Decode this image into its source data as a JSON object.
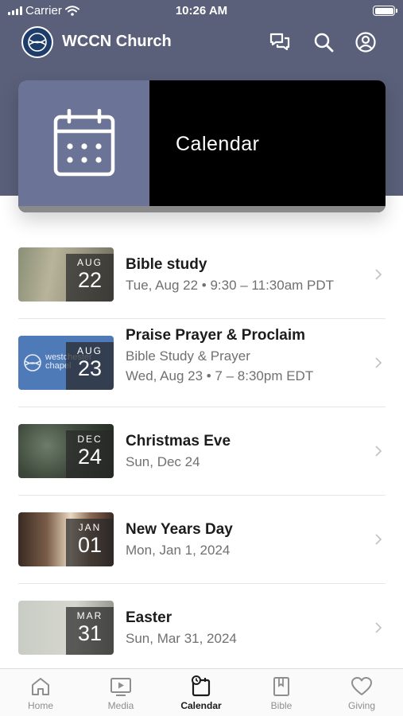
{
  "status_bar": {
    "carrier": "Carrier",
    "time": "10:26 AM"
  },
  "header": {
    "title": "WCCN Church"
  },
  "hero": {
    "title": "Calendar"
  },
  "events": [
    {
      "month": "AUG",
      "day": "22",
      "title": "Bible study",
      "lines": [
        "Tue, Aug 22 • 9:30 – 11:30am PDT"
      ]
    },
    {
      "month": "AUG",
      "day": "23",
      "title": "Praise Prayer & Proclaim",
      "lines": [
        "Bible Study & Prayer",
        "Wed, Aug 23 • 7 – 8:30pm EDT"
      ],
      "thumb_text": "westchester chapel"
    },
    {
      "month": "DEC",
      "day": "24",
      "title": "Christmas Eve",
      "lines": [
        "Sun, Dec 24"
      ]
    },
    {
      "month": "JAN",
      "day": "01",
      "title": "New Years Day",
      "lines": [
        "Mon, Jan 1, 2024"
      ]
    },
    {
      "month": "MAR",
      "day": "31",
      "title": "Easter",
      "lines": [
        "Sun, Mar 31, 2024"
      ]
    }
  ],
  "tabs": [
    {
      "label": "Home",
      "icon": "home-icon",
      "active": false
    },
    {
      "label": "Media",
      "icon": "media-icon",
      "active": false
    },
    {
      "label": "Calendar",
      "icon": "calendar-icon",
      "active": true
    },
    {
      "label": "Bible",
      "icon": "bible-icon",
      "active": false
    },
    {
      "label": "Giving",
      "icon": "heart-icon",
      "active": false
    }
  ],
  "colors": {
    "header_bg": "#5a6079",
    "hero_icon_bg": "#6b7497",
    "hero_bg": "#000000",
    "active_tab": "#1a1a1a",
    "inactive_tab": "#8e8e8e"
  }
}
